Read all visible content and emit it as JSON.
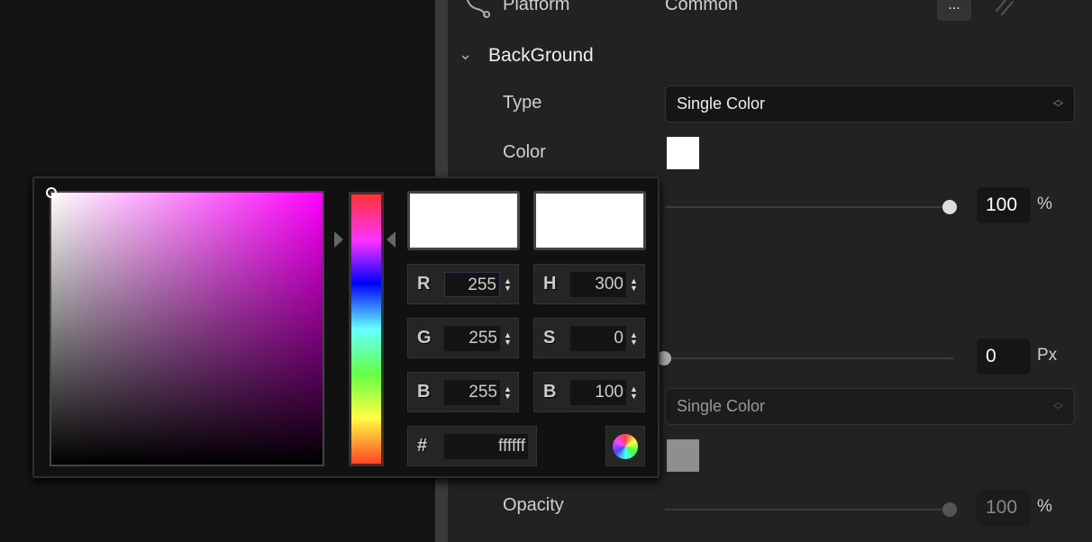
{
  "properties": {
    "platform_label": "Platform",
    "platform_value": "Common",
    "more_button": "...",
    "section_title": "BackGround",
    "type_label": "Type",
    "type_value": "Single Color",
    "color_label": "Color",
    "color_value": "#ffffff",
    "opacity_value": "100",
    "opacity_unit": "%",
    "opacity_fraction": 1.0,
    "border_value": "0",
    "border_unit": "Px",
    "border_fraction": 0,
    "type2_value": "Single Color",
    "color2_value": "#8f8f8f",
    "opacity2_label": "Opacity",
    "opacity2_value": "100",
    "opacity2_unit": "%"
  },
  "color_picker": {
    "hue": 300,
    "fields": [
      {
        "key": "R",
        "value": "255"
      },
      {
        "key": "H",
        "value": "300"
      },
      {
        "key": "G",
        "value": "255"
      },
      {
        "key": "S",
        "value": "0"
      },
      {
        "key": "B",
        "value": "255"
      },
      {
        "key": "B",
        "value": "100"
      }
    ],
    "hex_label": "#",
    "hex_value": "ffffff",
    "new_color": "#ffffff",
    "old_color": "#ffffff"
  }
}
